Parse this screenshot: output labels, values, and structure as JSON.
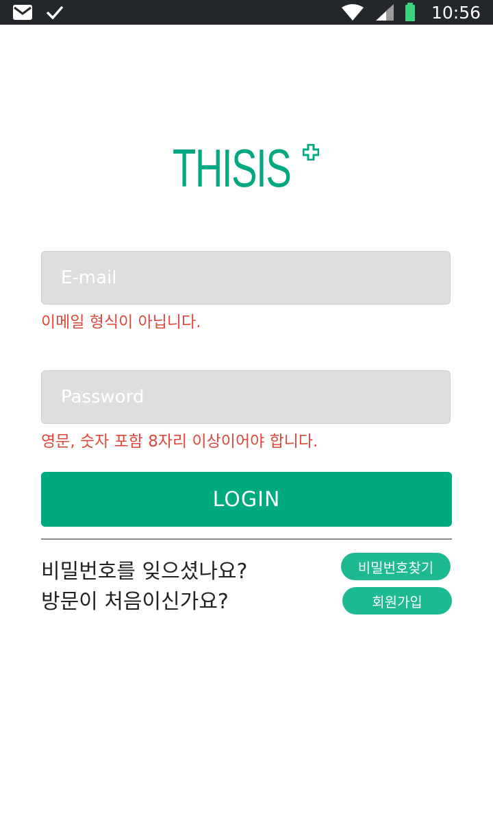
{
  "status_bar": {
    "time": "10:56",
    "icons": [
      "mail-icon",
      "check-icon",
      "wifi-icon",
      "signal-icon",
      "battery-icon"
    ]
  },
  "logo": {
    "text": "THISIS",
    "color": "#03a882"
  },
  "login_form": {
    "email": {
      "value": "",
      "placeholder": "E-mail",
      "error": "이메일 형식이 아닙니다."
    },
    "password": {
      "value": "",
      "placeholder": "Password",
      "error": "영문, 숫자 포함 8자리 이상이어야 합니다."
    },
    "login_label": "LOGIN"
  },
  "help": {
    "forgot_prompt": "비밀번호를 잊으셨나요?",
    "find_password_label": "비밀번호찾기",
    "new_prompt": "방문이 처음이신가요?",
    "signup_label": "회원가입"
  },
  "colors": {
    "accent": "#00aa80",
    "pill": "#1db993",
    "error": "#e0473a",
    "status_bar": "#23262a"
  }
}
